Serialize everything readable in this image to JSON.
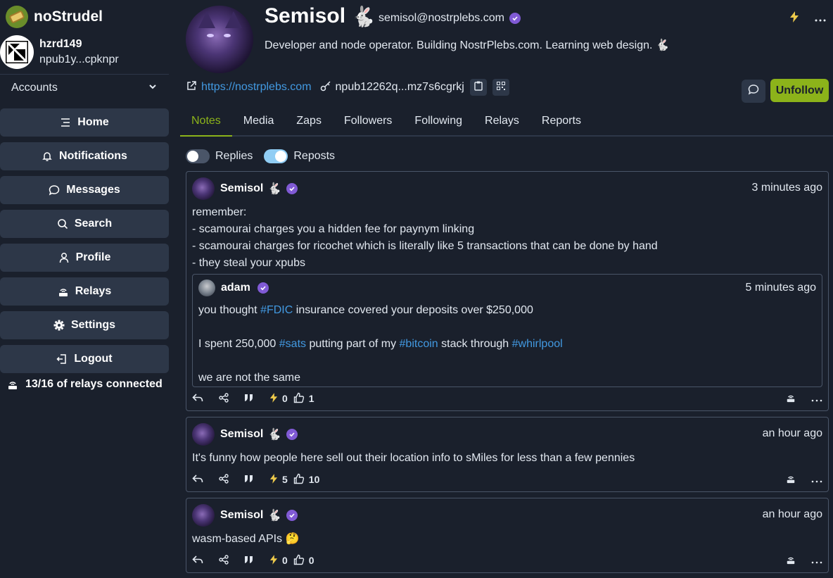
{
  "app": {
    "name": "noStrudel"
  },
  "account": {
    "name": "hzrd149",
    "npub": "npub1y...cpknpr"
  },
  "sidebar": {
    "accounts_label": "Accounts",
    "items": [
      {
        "label": "Home",
        "icon": "home-icon"
      },
      {
        "label": "Notifications",
        "icon": "bell-icon"
      },
      {
        "label": "Messages",
        "icon": "chat-icon"
      },
      {
        "label": "Search",
        "icon": "search-icon"
      },
      {
        "label": "Profile",
        "icon": "user-icon"
      },
      {
        "label": "Relays",
        "icon": "relay-icon"
      },
      {
        "label": "Settings",
        "icon": "gear-icon"
      },
      {
        "label": "Logout",
        "icon": "logout-icon"
      }
    ],
    "relay_status": "13/16 of relays connected"
  },
  "profile": {
    "name": "Semisol",
    "name_emoji": "🐇",
    "nip05": "semisol@nostrplebs.com",
    "bio": "Developer and node operator. Building NostrPlebs.com. Learning web design. 🐇",
    "website": "https://nostrplebs.com",
    "npub": "npub12262q...mz7s6cgrkj",
    "unfollow_label": "Unfollow"
  },
  "tabs": [
    "Notes",
    "Media",
    "Zaps",
    "Followers",
    "Following",
    "Relays",
    "Reports"
  ],
  "filters": {
    "replies_label": "Replies",
    "reposts_label": "Reposts"
  },
  "notes": [
    {
      "author": "Semisol",
      "emoji": "🐇",
      "time": "3 minutes ago",
      "lines": [
        "remember:",
        "- scamourai charges you a hidden fee for paynym linking",
        "- scamourai charges for ricochet which is literally like 5 transactions that can be done by hand",
        "- they steal your xpubs"
      ],
      "embed": {
        "author": "adam",
        "time": "5 minutes ago",
        "l1_a": "you thought ",
        "l1_tag": "#FDIC",
        "l1_b": " insurance covered your deposits over $250,000",
        "l2_a": "I spent 250,000 ",
        "l2_tag1": "#sats",
        "l2_b": " putting part of my ",
        "l2_tag2": "#bitcoin",
        "l2_c": " stack through ",
        "l2_tag3": "#whirlpool",
        "l3": "we are not the same"
      },
      "zaps": "0",
      "likes": "1"
    },
    {
      "author": "Semisol",
      "emoji": "🐇",
      "time": "an hour ago",
      "text": "It's funny how people here sell out their location info to sMiles for less than a few pennies",
      "zaps": "5",
      "likes": "10"
    },
    {
      "author": "Semisol",
      "emoji": "🐇",
      "time": "an hour ago",
      "text": "wasm-based APIs 🤔",
      "zaps": "0",
      "likes": "0"
    }
  ],
  "colors": {
    "accent": "#8cb31a",
    "link": "#4299e1",
    "verified": "#805ad5",
    "zap": "#ecc94b"
  }
}
